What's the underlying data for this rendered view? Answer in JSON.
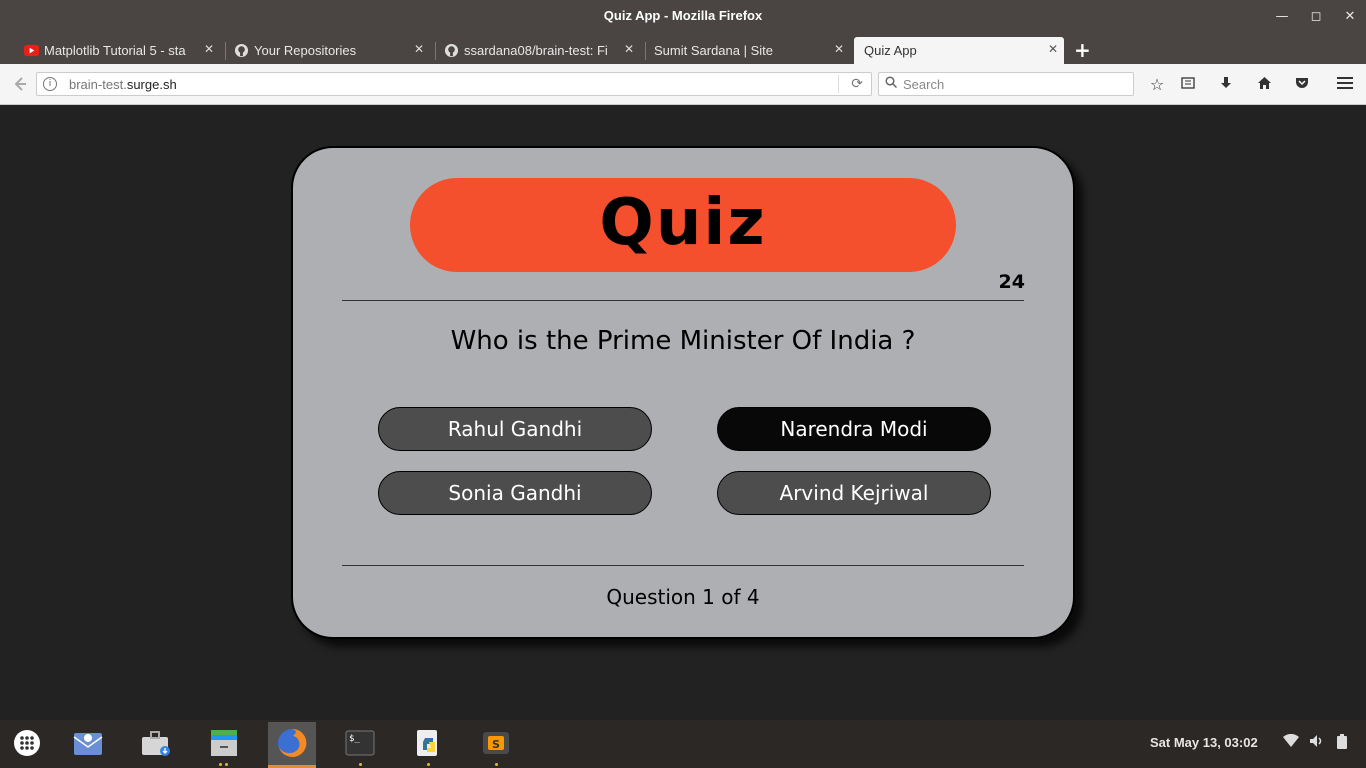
{
  "window": {
    "title": "Quiz App - Mozilla Firefox",
    "minimize": "—",
    "maximize": "◻",
    "close": "✕"
  },
  "tabs": [
    {
      "title": "Matplotlib Tutorial 5 - sta",
      "favicon": "youtube-icon",
      "close": "✕"
    },
    {
      "title": "Your Repositories",
      "favicon": "github-icon",
      "close": "✕"
    },
    {
      "title": "ssardana08/brain-test: Fi",
      "favicon": "github-icon",
      "close": "✕"
    },
    {
      "title": "Sumit Sardana | Site",
      "favicon": "",
      "close": "✕"
    },
    {
      "title": "Quiz App",
      "favicon": "",
      "close": "✕",
      "active": true
    }
  ],
  "newtab": "+",
  "navbar": {
    "url_prefix": "brain-test.",
    "url_domain": "surge.sh",
    "search_placeholder": "Search"
  },
  "quiz": {
    "title": "Quiz",
    "timer": "24",
    "question": "Who is the Prime Minister Of India ?",
    "options": [
      "Rahul Gandhi",
      "Narendra Modi",
      "Sonia Gandhi",
      "Arvind Kejriwal"
    ],
    "selected_option": "Narendra Modi",
    "counter": "Question 1 of 4"
  },
  "colors": {
    "page_bg": "#222222",
    "card_bg": "#adafb2",
    "banner": "#f4502e",
    "option_bg": "#4d4d4d",
    "option_selected_bg": "#080808"
  },
  "taskbar": {
    "clock": "Sat May 13, 03:02",
    "apps": [
      "app-grid-icon",
      "mail-icon",
      "store-icon",
      "files-icon",
      "firefox-icon",
      "terminal-icon",
      "python-icon",
      "sublime-icon"
    ]
  }
}
